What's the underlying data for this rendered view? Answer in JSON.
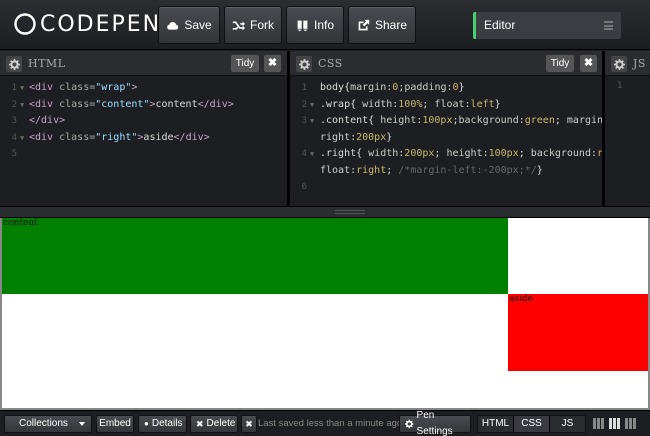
{
  "header": {
    "logo_text": "CODEPEN",
    "buttons": {
      "save": "Save",
      "fork": "Fork",
      "info": "Info",
      "share": "Share"
    },
    "view_select": "Editor"
  },
  "panes": {
    "html": {
      "title": "HTML",
      "tidy": "Tidy",
      "close": "✖",
      "lines": [
        {
          "n": "1",
          "fold": true,
          "tokens": [
            [
              "tag",
              "<div "
            ],
            [
              "attr",
              "class="
            ],
            [
              "str",
              "\"wrap\""
            ],
            [
              "tag",
              ">"
            ]
          ]
        },
        {
          "n": "2",
          "fold": true,
          "tokens": [
            [
              "tag",
              "<div "
            ],
            [
              "attr",
              "class="
            ],
            [
              "str",
              "\"content\""
            ],
            [
              "tag",
              ">"
            ],
            [
              "plain",
              "content"
            ],
            [
              "tag",
              "</div>"
            ]
          ]
        },
        {
          "n": "3",
          "fold": false,
          "tokens": [
            [
              "tag",
              "</div>"
            ]
          ]
        },
        {
          "n": "4",
          "fold": true,
          "tokens": [
            [
              "tag",
              "<div "
            ],
            [
              "attr",
              "class="
            ],
            [
              "str",
              "\"right\""
            ],
            [
              "tag",
              ">"
            ],
            [
              "plain",
              "aside"
            ],
            [
              "tag",
              "</div>"
            ]
          ]
        },
        {
          "n": "5",
          "fold": false,
          "tokens": []
        }
      ]
    },
    "css": {
      "title": "CSS",
      "tidy": "Tidy",
      "close": "✖",
      "lines": [
        {
          "n": "1",
          "fold": false,
          "tokens": [
            [
              "sel",
              "body"
            ],
            [
              "plain",
              "{"
            ],
            [
              "prop",
              "margin:"
            ],
            [
              "val",
              "0"
            ],
            [
              "plain",
              ";"
            ],
            [
              "prop",
              "padding:"
            ],
            [
              "val",
              "0"
            ],
            [
              "plain",
              "}"
            ]
          ]
        },
        {
          "n": "2",
          "fold": true,
          "tokens": [
            [
              "sel",
              ".wrap"
            ],
            [
              "plain",
              "{ "
            ],
            [
              "prop",
              "width:"
            ],
            [
              "val",
              "100%"
            ],
            [
              "plain",
              "; "
            ],
            [
              "prop",
              "float:"
            ],
            [
              "val",
              "left"
            ],
            [
              "plain",
              "}"
            ]
          ]
        },
        {
          "n": "3",
          "fold": true,
          "tokens": [
            [
              "sel",
              ".content"
            ],
            [
              "plain",
              "{ "
            ],
            [
              "prop",
              "height:"
            ],
            [
              "val",
              "100px"
            ],
            [
              "plain",
              ";"
            ],
            [
              "prop",
              "background:"
            ],
            [
              "val",
              "green"
            ],
            [
              "plain",
              "; "
            ],
            [
              "prop",
              "margin-"
            ]
          ]
        },
        {
          "n": "",
          "fold": false,
          "tokens": [
            [
              "prop",
              "right:"
            ],
            [
              "val",
              "200px"
            ],
            [
              "plain",
              "}"
            ]
          ]
        },
        {
          "n": "4",
          "fold": true,
          "tokens": [
            [
              "sel",
              ".right"
            ],
            [
              "plain",
              "{ "
            ],
            [
              "prop",
              "width:"
            ],
            [
              "val",
              "200px"
            ],
            [
              "plain",
              "; "
            ],
            [
              "prop",
              "height:"
            ],
            [
              "val",
              "100px"
            ],
            [
              "plain",
              "; "
            ],
            [
              "prop",
              "background:"
            ],
            [
              "val",
              "red"
            ],
            [
              "plain",
              ";"
            ]
          ]
        },
        {
          "n": "",
          "fold": false,
          "tokens": [
            [
              "prop",
              "float:"
            ],
            [
              "val",
              "right"
            ],
            [
              "plain",
              "; "
            ],
            [
              "cmt",
              "/*margin-left:-200px;*/"
            ],
            [
              "plain",
              "}"
            ]
          ]
        },
        {
          "n": "6",
          "fold": false,
          "tokens": []
        }
      ]
    },
    "js": {
      "title": "JS",
      "first_line": "1"
    }
  },
  "preview": {
    "content_text": "content",
    "aside_text": "aside",
    "colors": {
      "content": "#008000",
      "aside": "#ff0000"
    }
  },
  "footer": {
    "collections": "Collections",
    "embed": "Embed",
    "details": "Details",
    "delete": "Delete",
    "x": "✖",
    "saved_status": "Last saved less than a minute ago",
    "pen_settings": "Pen Settings",
    "view_tabs": [
      "HTML",
      "CSS",
      "JS"
    ]
  },
  "icons": {
    "save": "cloud-icon",
    "fork": "fork-icon",
    "info": "info-icon",
    "share": "share-icon",
    "settings": "gear-icon"
  },
  "colors": {
    "accent": "#47cf73",
    "background": "#1d1e22",
    "panel": "#2b2c30"
  }
}
